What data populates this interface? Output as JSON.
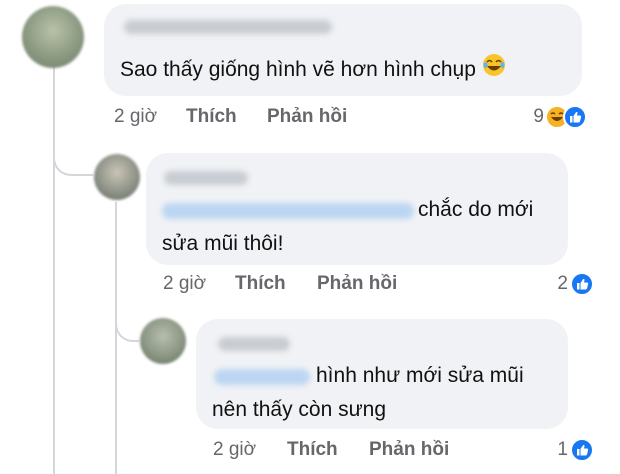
{
  "comments": [
    {
      "text_line1": "Sao thấy giống hình vẽ hơn hình chụp",
      "emoji": "laughing-crying-emoji",
      "time": "2 giờ",
      "like_label": "Thích",
      "reply_label": "Phản hồi",
      "reaction_count": "9",
      "reactions": [
        "haha-reaction-icon",
        "like-reaction-icon"
      ]
    },
    {
      "text_line1": "chắc do mới",
      "text_line2": "sửa mũi thôi!",
      "time": "2 giờ",
      "like_label": "Thích",
      "reply_label": "Phản hồi",
      "reaction_count": "2",
      "reactions": [
        "like-reaction-icon"
      ]
    },
    {
      "text_line1": "hình như mới sửa mũi",
      "text_line2": "nên thấy còn sưng",
      "time": "2 giờ",
      "like_label": "Thích",
      "reply_label": "Phản hồi",
      "reaction_count": "1",
      "reactions": [
        "like-reaction-icon"
      ]
    }
  ],
  "colors": {
    "bubble": "#f0f2f5",
    "action_text": "#65676b",
    "like_blue": "#1877f2",
    "haha_yellow": "#f7b125"
  }
}
